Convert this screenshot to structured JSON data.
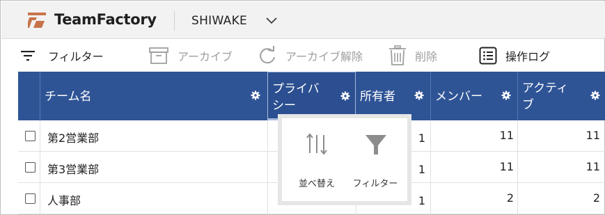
{
  "header": {
    "brand_bold": "Team",
    "brand_rest": "Factory",
    "workspace": "SHIWAKE"
  },
  "toolbar": {
    "filter_label": "フィルター",
    "archive_label": "アーカイブ",
    "unarchive_label": "アーカイブ解除",
    "delete_label": "削除",
    "log_label": "操作ログ"
  },
  "table": {
    "columns": {
      "name": "チーム名",
      "privacy": "プライバシー",
      "privacy_line1": "プライバ",
      "privacy_line2": "シー",
      "owners": "所有者",
      "members": "メンバー",
      "active": "アクティブ",
      "active_line1": "アクティ",
      "active_line2": "ブ"
    },
    "rows": [
      {
        "name": "第2営業部",
        "owners": "1",
        "members": "11",
        "active": "11"
      },
      {
        "name": "第3営業部",
        "owners": "1",
        "members": "11",
        "active": "11"
      },
      {
        "name": "人事部",
        "owners": "1",
        "members": "2",
        "active": "2"
      }
    ]
  },
  "popup": {
    "sort_label": "並べ替え",
    "filter_label": "フィルター"
  },
  "colors": {
    "header_blue": "#2f5496",
    "brand_orange": "#c8744b"
  }
}
